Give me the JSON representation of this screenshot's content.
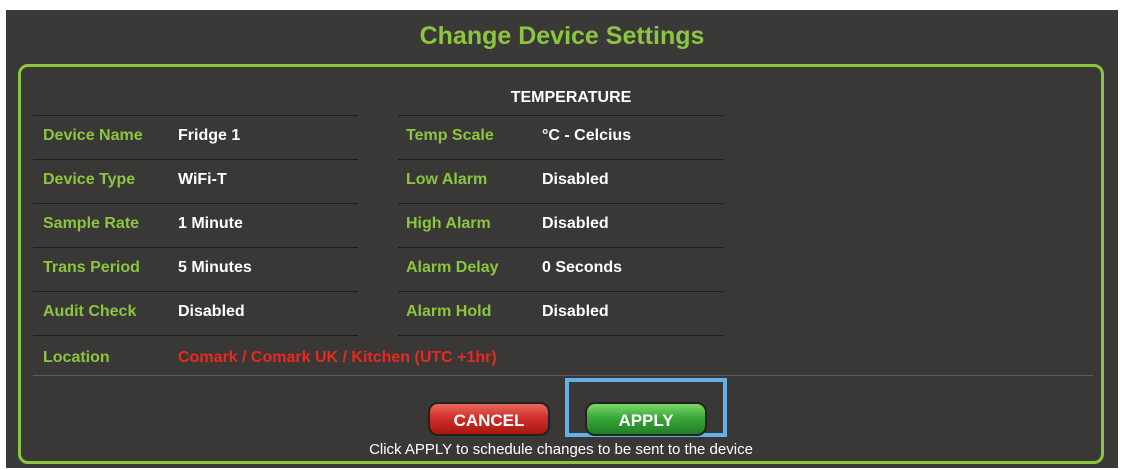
{
  "dialog": {
    "title": "Change Device Settings",
    "section_heading": "TEMPERATURE"
  },
  "left_fields": [
    {
      "label": "Device Name",
      "value": "Fridge 1"
    },
    {
      "label": "Device Type",
      "value": "WiFi-T"
    },
    {
      "label": "Sample Rate",
      "value": "1 Minute"
    },
    {
      "label": "Trans Period",
      "value": "5 Minutes"
    },
    {
      "label": "Audit Check",
      "value": "Disabled"
    }
  ],
  "right_fields": [
    {
      "label": "Temp Scale",
      "value": "°C - Celcius"
    },
    {
      "label": "Low Alarm",
      "value": "Disabled"
    },
    {
      "label": "High Alarm",
      "value": "Disabled"
    },
    {
      "label": "Alarm Delay",
      "value": "0 Seconds"
    },
    {
      "label": "Alarm Hold",
      "value": "Disabled"
    }
  ],
  "location": {
    "label": "Location",
    "value": "Comark  / Comark UK  / Kitchen   (UTC +1hr)"
  },
  "buttons": {
    "cancel_label": "CANCEL",
    "apply_label": "APPLY"
  },
  "hint": "Click APPLY to schedule changes to be sent to the device",
  "colors": {
    "accent_green": "#8cc63f",
    "background": "#3a3938",
    "location_red": "#e82a20",
    "highlight_blue": "#5fb1e6"
  }
}
